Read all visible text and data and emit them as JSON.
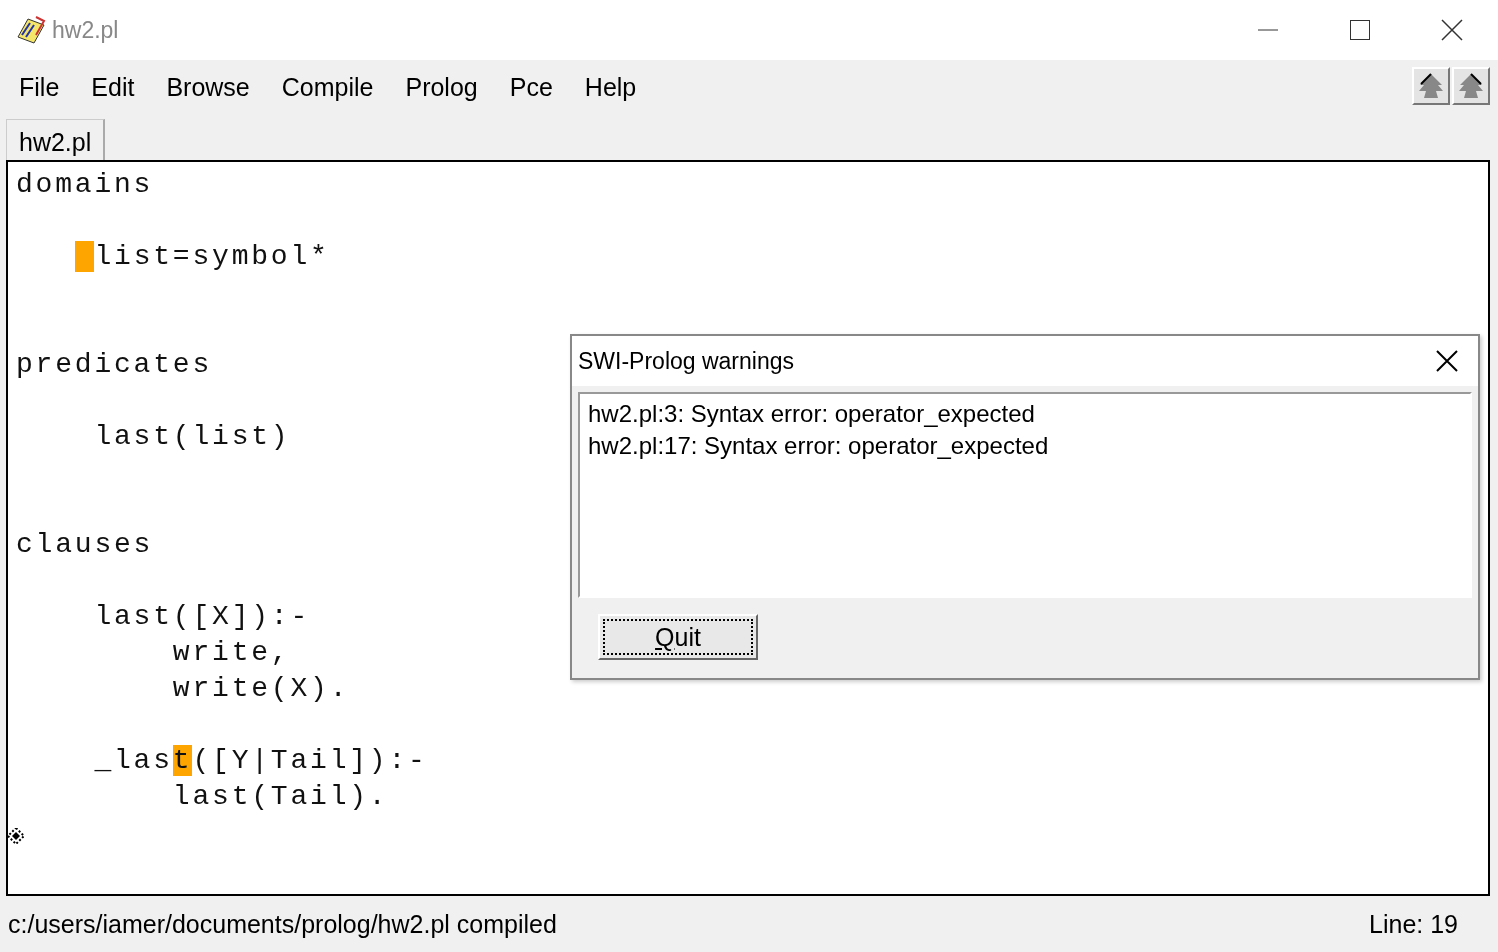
{
  "window": {
    "title": "hw2.pl"
  },
  "menu": [
    "File",
    "Edit",
    "Browse",
    "Compile",
    "Prolog",
    "Pce",
    "Help"
  ],
  "tabs": [
    {
      "label": "hw2.pl",
      "selected": true
    }
  ],
  "editor": {
    "lines": [
      {
        "kind": "code",
        "cursor": false,
        "segments": [
          {
            "text": "domains",
            "highlighted": false
          }
        ]
      },
      {
        "kind": "blank"
      },
      {
        "kind": "code",
        "cursor": true,
        "segments": [
          {
            "text": "    list=symbol*",
            "highlighted": false
          }
        ]
      },
      {
        "kind": "blank"
      },
      {
        "kind": "blank"
      },
      {
        "kind": "code",
        "cursor": false,
        "segments": [
          {
            "text": "predicates",
            "highlighted": false
          }
        ]
      },
      {
        "kind": "blank"
      },
      {
        "kind": "code",
        "cursor": false,
        "segments": [
          {
            "text": "    last(list)",
            "highlighted": false
          }
        ]
      },
      {
        "kind": "blank"
      },
      {
        "kind": "blank"
      },
      {
        "kind": "code",
        "cursor": false,
        "segments": [
          {
            "text": "clauses",
            "highlighted": false
          }
        ]
      },
      {
        "kind": "blank"
      },
      {
        "kind": "code",
        "cursor": false,
        "segments": [
          {
            "text": "    last([X]):-",
            "highlighted": false
          }
        ]
      },
      {
        "kind": "code",
        "cursor": false,
        "segments": [
          {
            "text": "        write,",
            "highlighted": false
          }
        ]
      },
      {
        "kind": "code",
        "cursor": false,
        "segments": [
          {
            "text": "        write(X).",
            "highlighted": false
          }
        ]
      },
      {
        "kind": "blank"
      },
      {
        "kind": "code",
        "cursor": false,
        "segments": [
          {
            "text": "    _las",
            "highlighted": false
          },
          {
            "text": "t",
            "highlighted": true
          },
          {
            "text": "([Y|Tail]):-",
            "highlighted": false
          }
        ]
      },
      {
        "kind": "code",
        "cursor": false,
        "segments": [
          {
            "text": "        last(Tail).",
            "highlighted": false
          }
        ]
      },
      {
        "kind": "marker"
      }
    ]
  },
  "dialog": {
    "title": "SWI-Prolog warnings",
    "messages": [
      "hw2.pl:3: Syntax error: operator_expected",
      "hw2.pl:17: Syntax error: operator_expected"
    ],
    "button": "Quit"
  },
  "status_bar": {
    "message": "c:/users/iamer/documents/prolog/hw2.pl compiled",
    "line": "Line: 19"
  }
}
